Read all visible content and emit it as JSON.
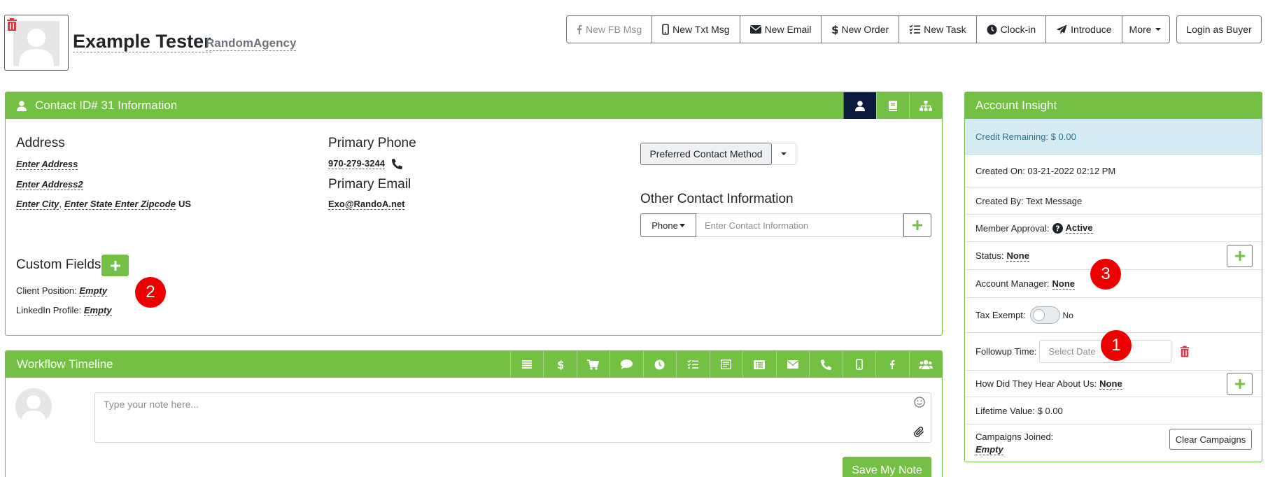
{
  "header": {
    "name": "Example Tester",
    "agency": "RandomAgency",
    "actions": [
      {
        "label": "New FB Msg",
        "icon": "facebook-icon"
      },
      {
        "label": "New Txt Msg",
        "icon": "mobile-icon"
      },
      {
        "label": "New Email",
        "icon": "envelope-icon"
      },
      {
        "label": "New Order",
        "icon": "dollar-icon"
      },
      {
        "label": "New Task",
        "icon": "tasks-icon"
      },
      {
        "label": "Clock-in",
        "icon": "clock-icon"
      },
      {
        "label": "Introduce",
        "icon": "paper-plane-icon"
      },
      {
        "label": "More",
        "icon": "caret-down-icon"
      }
    ],
    "login_label": "Login as Buyer"
  },
  "contact": {
    "title": "Contact ID# 31 Information",
    "address_heading": "Address",
    "address1": "Enter Address",
    "address2": "Enter Address2",
    "city": "Enter City",
    "sep": ",",
    "state_zip": "Enter State Enter Zipcode",
    "country": "US",
    "phone_heading": "Primary Phone",
    "phone": "970-279-3244",
    "email_heading": "Primary Email",
    "email": "Exo@RandoA.net",
    "preferred_label": "Preferred Contact Method",
    "other_heading": "Other Contact Information",
    "phone_select": "Phone",
    "contact_placeholder": "Enter Contact Information",
    "custom_heading": "Custom Fields",
    "custom_fields": [
      {
        "label": "Client Position:",
        "value": "Empty"
      },
      {
        "label": "LinkedIn Profile:",
        "value": "Empty"
      }
    ]
  },
  "workflow": {
    "title": "Workflow Timeline",
    "note_placeholder": "Type your note here...",
    "save_label": "Save My Note"
  },
  "insight": {
    "title": "Account Insight",
    "credit": "Credit Remaining: $ 0.00",
    "created_on": "Created On: 03-21-2022 02:12 PM",
    "created_by": "Created By: Text Message",
    "member_approval_label": "Member Approval:",
    "member_approval_value": "Active",
    "status_label": "Status:",
    "status_value": "None",
    "manager_label": "Account Manager:",
    "manager_value": "None",
    "tax_label": "Tax Exempt:",
    "tax_value": "No",
    "followup_label": "Followup Time:",
    "followup_placeholder": "Select Date",
    "hear_label": "How Did They Hear About Us:",
    "hear_value": "None",
    "lifetime": "Lifetime Value: $ 0.00",
    "campaigns_label": "Campaigns Joined:",
    "campaigns_value": "Empty",
    "clear_label": "Clear Campaigns"
  },
  "markers": [
    "1",
    "2",
    "3"
  ],
  "colors": {
    "accent": "#74c044",
    "marker": "#ee0000",
    "active_tab": "#0b1b3d",
    "credit_bg": "#d6ecf4"
  }
}
